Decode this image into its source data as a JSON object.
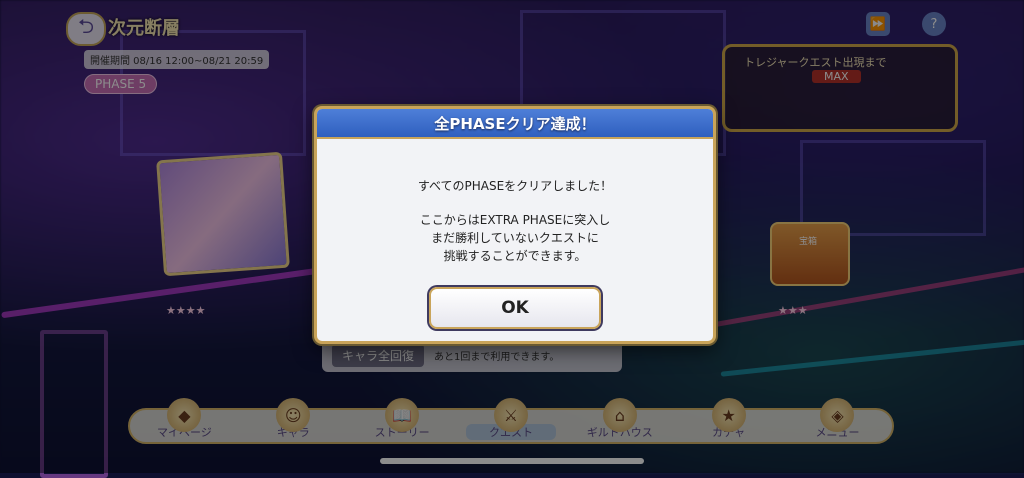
{
  "header": {
    "back_icon": "back-arrow-icon",
    "event_title": "次元断層",
    "event_period": "開催期間 08/16 12:00~08/21 20:59",
    "phase_badge": "PHASE 5"
  },
  "top_right": {
    "skip_label": "スキップ",
    "help_label": "ヘルプ",
    "treasure_label": "トレジャークエスト出現まで",
    "treasure_status": "MAX"
  },
  "stage": {
    "chest_label": "宝箱",
    "chara_button_label": "キャラ全回復",
    "chara_button_note": "あと1回まで利用できます。"
  },
  "nav": {
    "items": [
      {
        "label": "マイページ",
        "icon": "crystal-icon"
      },
      {
        "label": "キャラ",
        "icon": "character-icon"
      },
      {
        "label": "ストーリー",
        "icon": "book-icon"
      },
      {
        "label": "クエスト",
        "icon": "sword-icon"
      },
      {
        "label": "ギルドハウス",
        "icon": "house-icon"
      },
      {
        "label": "ガチャ",
        "icon": "gacha-icon"
      },
      {
        "label": "メニュー",
        "icon": "menu-icon"
      }
    ],
    "active_index": 3
  },
  "dialog": {
    "title": "全PHASEクリア達成！",
    "line1": "すべてのPHASEをクリアしました！",
    "line2": "ここからはEXTRA PHASEに突入し",
    "line3": "まだ勝利していないクエストに",
    "line4": "挑戦することができます。",
    "ok_label": "OK"
  },
  "colors": {
    "dialog_header": "#3a6ccb",
    "gold_border": "#c9a45a"
  }
}
